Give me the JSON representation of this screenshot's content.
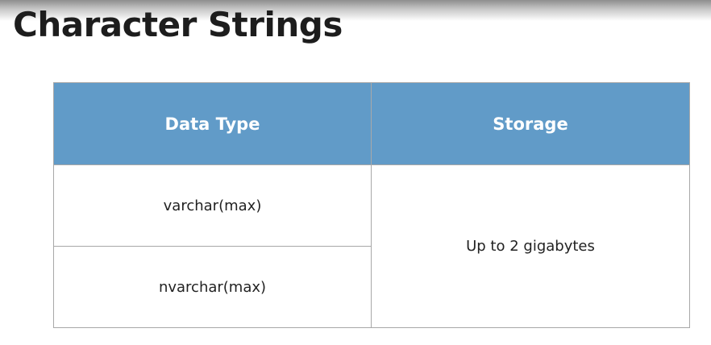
{
  "slide": {
    "title": "Character Strings"
  },
  "table": {
    "headers": [
      "Data Type",
      "Storage"
    ],
    "rows": [
      {
        "data_type": "varchar(max)"
      },
      {
        "data_type": "nvarchar(max)"
      }
    ],
    "storage_merged": "Up to 2 gigabytes"
  },
  "colors": {
    "header_bg": "#619bc8",
    "header_text": "#ffffff",
    "border": "#a8a8a8"
  }
}
